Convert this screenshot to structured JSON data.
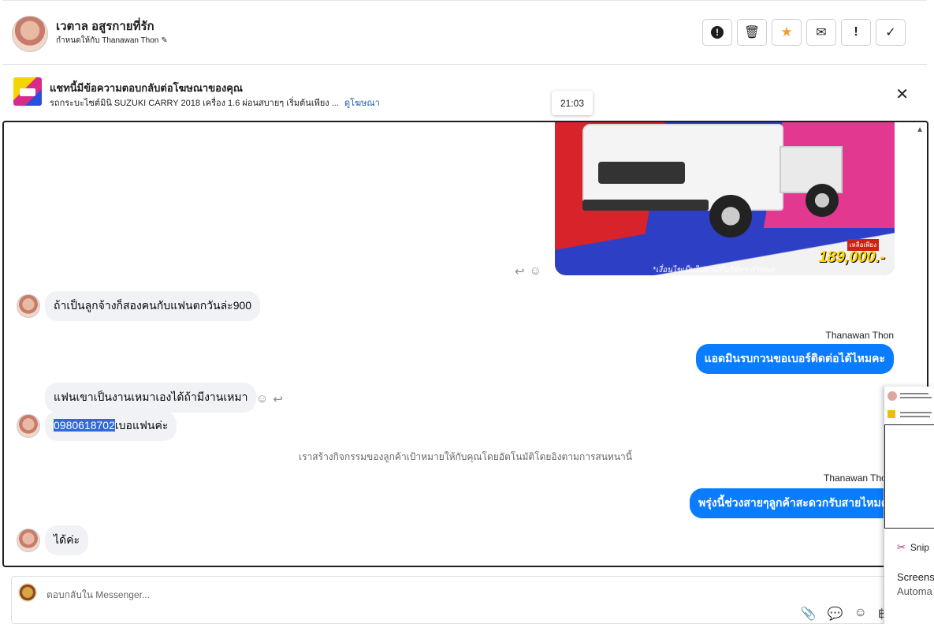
{
  "header": {
    "name": "เวตาล อสูรกายที่รัก",
    "assigned": "กำหนดให้กับ Thanawan Thon",
    "edit_icon": "pencil-icon",
    "actions": [
      {
        "name": "spam-button",
        "icon": "!",
        "kind": "circle"
      },
      {
        "name": "delete-button",
        "icon": "🗑",
        "kind": "plain"
      },
      {
        "name": "star-button",
        "icon": "★",
        "kind": "star"
      },
      {
        "name": "mark-unread-button",
        "icon": "✉",
        "kind": "plain"
      },
      {
        "name": "follow-up-button",
        "icon": "!",
        "kind": "plain"
      },
      {
        "name": "done-button",
        "icon": "✓",
        "kind": "plain"
      }
    ]
  },
  "ad": {
    "title": "แชทนี้มีข้อความตอบกลับต่อโฆษณาของคุณ",
    "subtitle": "รถกระบะไซต์มินิ SUZUKI CARRY 2018 เครื่อง 1.6 ผ่อนสบายๆ เริ่มต้นเพียง ...",
    "link": "ดูโฆษณา",
    "close": "✕"
  },
  "tooltip_time": "21:03",
  "image": {
    "price": "189,000.-",
    "tag": "เหลือเพียง",
    "note": "*เงื่อนไขเป็นไปตามที่บริษัทฯ กำหนด"
  },
  "messages": {
    "m1": "ถ้าเป็นลูกจ้างก็สองคนกับแฟนตกวันล่ะ900",
    "sender1": "Thanawan Thon",
    "m2": "แอดมินรบกวนขอเบอร์ติดต่อได้ไหมคะ",
    "m3": "แฟนเขาเป็นงานเหมาเองได้ถ้ามีงานเหมา",
    "m4_phone": "0980618702",
    "m4_rest": "เบอแฟนค่ะ",
    "system": "เราสร้างกิจกรรมของลูกค้าเป้าหมายให้กับคุณโดยอัตโนมัติโดยอิงตามการสนทนานี้",
    "sender2": "Thanawan Thon",
    "m5": "พรุ่งนี้ช่วงสายๆลูกค้าสะดวกรับสายไหมคะ",
    "m6": "ได้ค่ะ"
  },
  "composer": {
    "placeholder": "ตอบกลับใน Messenger...",
    "tools": [
      "📎",
      "💬",
      "☺",
      "฿"
    ]
  },
  "snip": {
    "app": "Snip",
    "title": "Screens",
    "subtitle": "Automa"
  }
}
